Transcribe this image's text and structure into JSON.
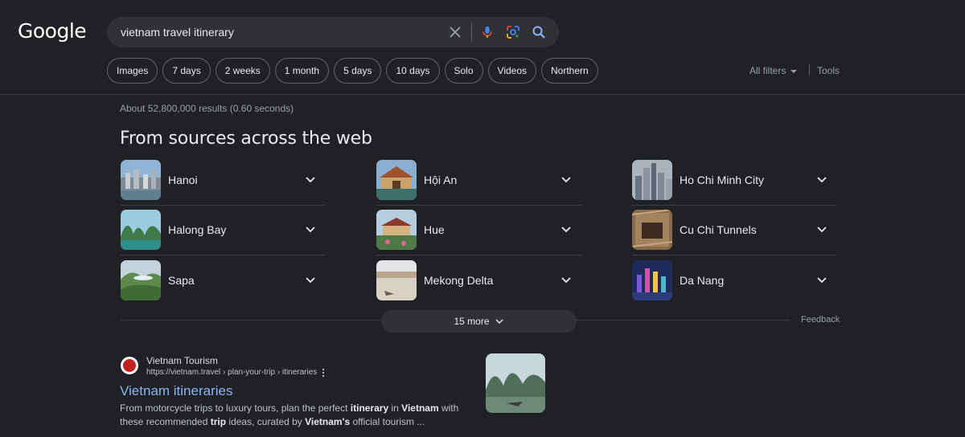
{
  "logo": "Google",
  "search": {
    "query": "vietnam travel itinerary"
  },
  "chips": [
    "Images",
    "7 days",
    "2 weeks",
    "1 month",
    "5 days",
    "10 days",
    "Solo",
    "Videos",
    "Northern"
  ],
  "filters": {
    "all_filters": "All filters",
    "tools": "Tools"
  },
  "stats": "About 52,800,000 results (0.60 seconds)",
  "section_title": "From sources across the web",
  "places": [
    {
      "name": "Hanoi",
      "icon": "city-photo"
    },
    {
      "name": "Hội An",
      "icon": "bridge-photo"
    },
    {
      "name": "Ho Chi Minh City",
      "icon": "skyline-photo"
    },
    {
      "name": "Halong Bay",
      "icon": "bay-photo"
    },
    {
      "name": "Hue",
      "icon": "citadel-photo"
    },
    {
      "name": "Cu Chi Tunnels",
      "icon": "tunnel-photo"
    },
    {
      "name": "Sapa",
      "icon": "mountain-photo"
    },
    {
      "name": "Mekong Delta",
      "icon": "river-photo"
    },
    {
      "name": "Da Nang",
      "icon": "night-city-photo"
    }
  ],
  "more_button": "15 more",
  "feedback": "Feedback",
  "result": {
    "site_name": "Vietnam Tourism",
    "url": "https://vietnam.travel › plan-your-trip › itineraries",
    "title": "Vietnam itineraries",
    "snippet_parts": [
      {
        "t": "From motorcycle trips to luxury tours, plan the perfect ",
        "b": false
      },
      {
        "t": "itinerary",
        "b": true
      },
      {
        "t": " in ",
        "b": false
      },
      {
        "t": "Vietnam",
        "b": true
      },
      {
        "t": " with these recommended ",
        "b": false
      },
      {
        "t": "trip",
        "b": true
      },
      {
        "t": " ideas, curated by ",
        "b": false
      },
      {
        "t": "Vietnam's",
        "b": true
      },
      {
        "t": " official tourism ...",
        "b": false
      }
    ]
  },
  "colors": {
    "background": "#202124",
    "link": "#8ab4f8",
    "surface": "#303134"
  }
}
